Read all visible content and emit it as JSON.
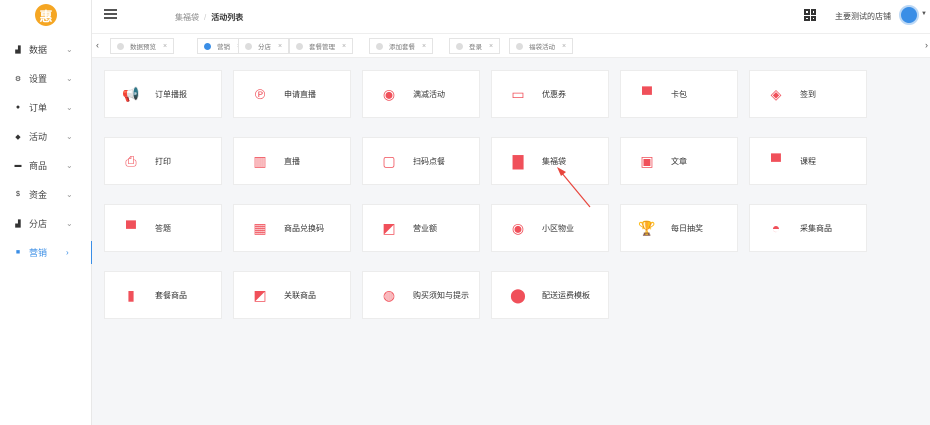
{
  "app": {
    "logo_char": "惠",
    "store_name": "主要测试的店铺"
  },
  "sidebar": {
    "items": [
      {
        "label": "数据",
        "icon": "bar-chart-icon",
        "glyph": "▟"
      },
      {
        "label": "设置",
        "icon": "gear-icon",
        "glyph": "⚙"
      },
      {
        "label": "订单",
        "icon": "order-icon",
        "glyph": "●"
      },
      {
        "label": "活动",
        "icon": "tag-icon",
        "glyph": "◆"
      },
      {
        "label": "商品",
        "icon": "goods-icon",
        "glyph": "▬"
      },
      {
        "label": "资金",
        "icon": "dollar-icon",
        "glyph": "$"
      },
      {
        "label": "分店",
        "icon": "branch-icon",
        "glyph": "▟"
      },
      {
        "label": "营销",
        "icon": "marketing-icon",
        "glyph": "■"
      }
    ],
    "active_index": 7
  },
  "header": {
    "breadcrumb": [
      "集福袋",
      "活动列表"
    ]
  },
  "tabs": [
    {
      "label": "数据预览",
      "active": false
    },
    {
      "label": "营销",
      "active": true
    },
    {
      "label": "分店",
      "active": false
    },
    {
      "label": "套餐管理",
      "active": false
    },
    {
      "label": "添加套餐",
      "active": false
    },
    {
      "label": "登录",
      "active": false
    },
    {
      "label": "福袋活动",
      "active": false
    }
  ],
  "cards": [
    {
      "label": "订单播报",
      "icon": "megaphone-icon"
    },
    {
      "label": "申请直播",
      "icon": "pinterest-icon"
    },
    {
      "label": "满减活动",
      "icon": "record-icon"
    },
    {
      "label": "优惠券",
      "icon": "credit-card-icon"
    },
    {
      "label": "卡包",
      "icon": "presentation-icon"
    },
    {
      "label": "签到",
      "icon": "cube-icon"
    },
    {
      "label": "打印",
      "icon": "printer-icon"
    },
    {
      "label": "直播",
      "icon": "barcode-icon"
    },
    {
      "label": "扫码点餐",
      "icon": "monitor-icon"
    },
    {
      "label": "集福袋",
      "icon": "layers-icon"
    },
    {
      "label": "文章",
      "icon": "calendar-icon"
    },
    {
      "label": "课程",
      "icon": "presentation-icon"
    },
    {
      "label": "答题",
      "icon": "presentation-icon"
    },
    {
      "label": "商品兑换码",
      "icon": "shopping-bag-icon"
    },
    {
      "label": "营业额",
      "icon": "line-chart-icon"
    },
    {
      "label": "小区物业",
      "icon": "record-icon"
    },
    {
      "label": "每日抽奖",
      "icon": "trophy-icon"
    },
    {
      "label": "采集商品",
      "icon": "gauge-icon"
    },
    {
      "label": "套餐商品",
      "icon": "book-icon"
    },
    {
      "label": "关联商品",
      "icon": "line-chart-icon"
    },
    {
      "label": "购买须知与提示",
      "icon": "basketball-icon"
    },
    {
      "label": "配送运费模板",
      "icon": "map-marker-icon"
    }
  ],
  "colors": {
    "accent": "#3a8ee6",
    "icon_red": "#f0505a"
  }
}
